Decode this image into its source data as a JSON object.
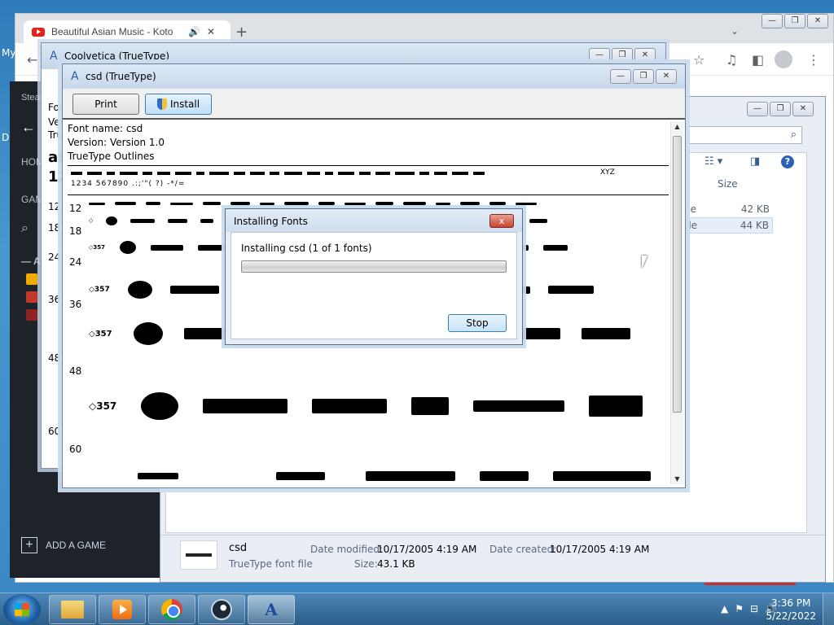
{
  "desktop": {
    "left_labels": [
      "My",
      "D"
    ]
  },
  "chrome": {
    "tab_title": "Beautiful Asian Music - Koto",
    "new_tab_symbol": "+",
    "dropdown_symbol": "⌄"
  },
  "steam": {
    "steam_label": "Steam",
    "home_label": "HOM",
    "games_label": "GAM",
    "all_label": "ALL",
    "add_game_label": "ADD A GAME"
  },
  "explorer": {
    "col_size": "Size",
    "rows": [
      {
        "name_fragment": "ile",
        "size": "42 KB"
      },
      {
        "name_fragment": "ile",
        "size": "44 KB"
      }
    ],
    "details": {
      "name": "csd",
      "type": "TrueType font file",
      "date_modified_label": "Date modified:",
      "date_modified": "10/17/2005 4:19 AM",
      "date_created_label": "Date created:",
      "date_created": "10/17/2005 4:19 AM",
      "size_label": "Size:",
      "size": "43.1 KB"
    }
  },
  "coolvetica": {
    "title": "Coolvetica (TrueType)",
    "peek_lines": [
      "Fon",
      "Ver",
      "Tru"
    ],
    "peek_big": [
      "ab",
      "12"
    ],
    "sizes": [
      "12",
      "18",
      "24",
      "36",
      "48",
      "60"
    ]
  },
  "csd_viewer": {
    "title": "csd (TrueType)",
    "print_label": "Print",
    "install_label": "Install",
    "font_name": "Font name: csd",
    "version": "Version: Version 1.0",
    "outlines": "TrueType Outlines",
    "char_sample_tail": "XYZ",
    "number_line": "1234 567890  .:;'\"( ?) -*/=",
    "sizes": [
      "12",
      "18",
      "24",
      "36",
      "48",
      "60"
    ],
    "bullet_label": "357"
  },
  "installing_dialog": {
    "title": "Installing Fonts",
    "status": "Installing csd (1 of 1 fonts)",
    "progress": 0.0,
    "stop_label": "Stop",
    "close_symbol": "x"
  },
  "taskbar": {
    "time": "3:36 PM",
    "date": "5/22/2022"
  },
  "colors": {
    "desktop": "#3a86c3",
    "steam_bg": "#1e2329",
    "win7_caption": "#c8d8ec",
    "close_red": "#c9402e"
  }
}
